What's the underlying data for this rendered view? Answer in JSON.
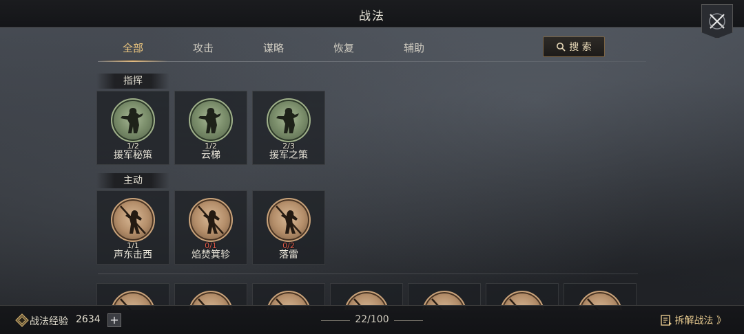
{
  "window": {
    "title": "战法"
  },
  "tabs": [
    {
      "label": "全部",
      "active": true
    },
    {
      "label": "攻击",
      "active": false
    },
    {
      "label": "谋略",
      "active": false
    },
    {
      "label": "恢复",
      "active": false
    },
    {
      "label": "辅助",
      "active": false
    }
  ],
  "search": {
    "label": "搜 索",
    "icon": "search-icon"
  },
  "sections": [
    {
      "label": "指挥",
      "medal_color": "green",
      "cards": [
        {
          "name": "援军秘策",
          "count": "1/2"
        },
        {
          "name": "云梯",
          "count": "1/2"
        },
        {
          "name": "援军之策",
          "count": "2/3"
        }
      ]
    },
    {
      "label": "主动",
      "medal_color": "bronze",
      "cards": [
        {
          "name": "声东击西",
          "count": "1/1"
        },
        {
          "name": "焰焚箕轸",
          "count": "0/1"
        },
        {
          "name": "落雷",
          "count": "0/2"
        }
      ]
    }
  ],
  "bottom": {
    "exp_label": "战法经验",
    "exp_value": "2634",
    "add_label": "+",
    "page_count": "22/100",
    "decompose_label": "拆解战法 》"
  },
  "colors": {
    "accent_gold": "#d9a65c",
    "zero_count_red": "#e05a48",
    "medal_green": "#7c8f6c",
    "medal_bronze": "#b48e6a"
  }
}
